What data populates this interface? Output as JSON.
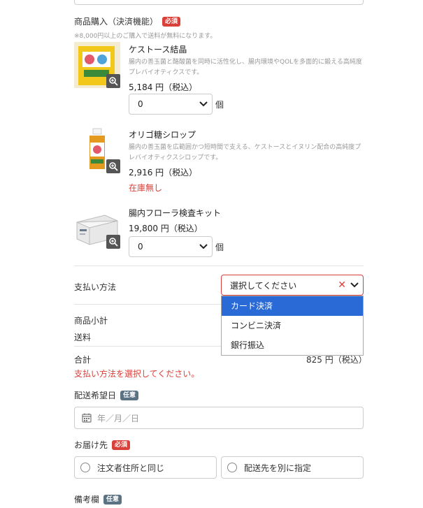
{
  "purchase": {
    "title": "商品購入（決済機能）",
    "required_badge": "必須",
    "note": "※8,000円以上のご購入で送料が無料になります。"
  },
  "products": [
    {
      "name": "ケストース結晶",
      "desc": "腸内の善玉菌と酪酸菌を同時に活性化し、腸内環境やQOLを多面的に鍛える高純度プレバイオティクスです。",
      "price": "5,184 円（税込）",
      "qty": "0",
      "unit": "個"
    },
    {
      "name": "オリゴ糖シロップ",
      "desc": "腸内の善玉菌を広範囲かつ短時間で支える、ケストースとイヌリン配合の高純度プレバイオティクスシロップです。",
      "price": "2,916 円（税込）",
      "stock": "在庫無し"
    },
    {
      "name": "腸内フローラ検査キット",
      "price": "19,800 円（税込）",
      "qty": "0",
      "unit": "個"
    }
  ],
  "payment": {
    "label": "支払い方法",
    "placeholder": "選択してください",
    "options": [
      "カード決済",
      "コンビニ決済",
      "銀行振込"
    ]
  },
  "summary": {
    "subtotal_label": "商品小計",
    "shipping_label": "送料",
    "total_label": "合計",
    "total_value": "825 円（税込）",
    "error": "支払い方法を選択してください。"
  },
  "delivery_date": {
    "label": "配送希望日",
    "optional_badge": "任意",
    "placeholder": "年／月／日"
  },
  "ship_to": {
    "label": "お届け先",
    "required_badge": "必須",
    "option_same": "注文者住所と同じ",
    "option_other": "配送先を別に指定"
  },
  "remarks": {
    "label": "備考欄",
    "optional_badge": "任意"
  },
  "colors": {
    "required": "#d9403a",
    "optional": "#5b7283",
    "dropdown_active": "#2a6ad6"
  }
}
